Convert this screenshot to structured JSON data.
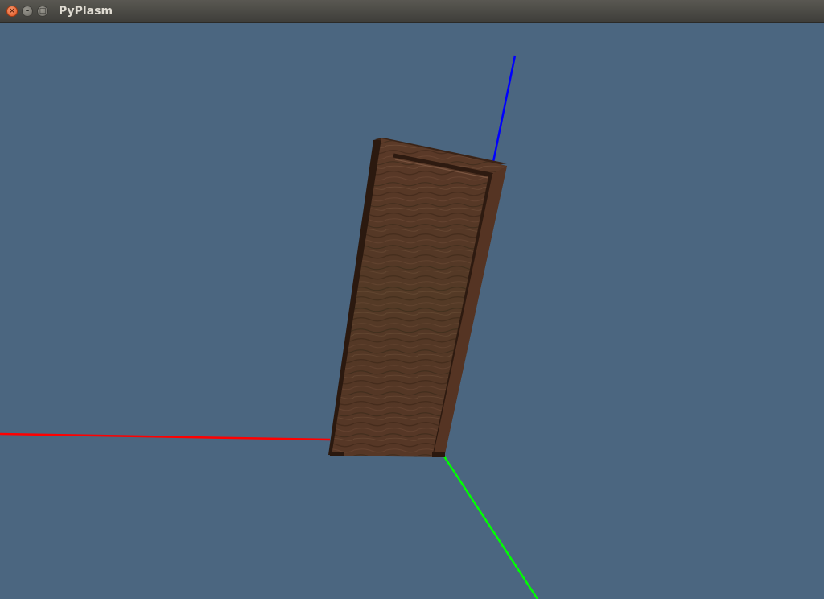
{
  "window": {
    "title": "PyPlasm",
    "controls": {
      "close_glyph": "×",
      "minimize_glyph": "–",
      "maximize_glyph": "□"
    }
  },
  "viewport": {
    "background_color": "#4b6680",
    "axes": {
      "x_color": "#ff0000",
      "y_color": "#00ff00",
      "z_color": "#0000ff"
    },
    "object": {
      "type": "wooden-door",
      "wood_color": "#5a3826"
    }
  }
}
